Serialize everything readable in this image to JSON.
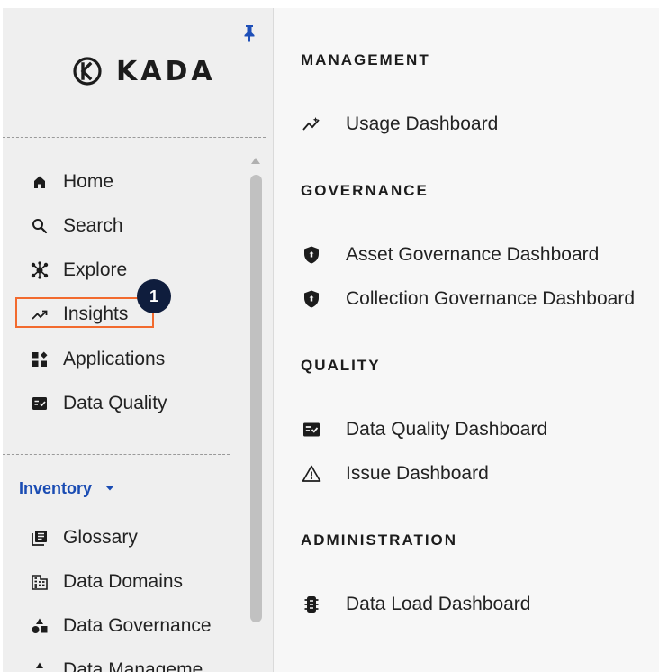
{
  "logo": {
    "text": "KADA"
  },
  "sidebar": {
    "nav": [
      {
        "label": "Home",
        "icon": "home-icon"
      },
      {
        "label": "Search",
        "icon": "search-icon"
      },
      {
        "label": "Explore",
        "icon": "explore-icon"
      },
      {
        "label": "Insights",
        "icon": "trending-up-icon"
      },
      {
        "label": "Applications",
        "icon": "applications-icon"
      },
      {
        "label": "Data Quality",
        "icon": "data-quality-icon"
      }
    ],
    "highlight_badge": "1",
    "inventory": {
      "label": "Inventory",
      "items": [
        {
          "label": "Glossary",
          "icon": "glossary-icon"
        },
        {
          "label": "Data Domains",
          "icon": "domains-icon"
        },
        {
          "label": "Data Governance",
          "icon": "governance-icon"
        },
        {
          "label": "Data Manageme",
          "icon": "management-icon"
        }
      ]
    }
  },
  "menu": {
    "sections": [
      {
        "title": "MANAGEMENT",
        "items": [
          {
            "label": "Usage Dashboard",
            "icon": "usage-icon"
          }
        ]
      },
      {
        "title": "GOVERNANCE",
        "items": [
          {
            "label": "Asset Governance Dashboard",
            "icon": "shield-icon"
          },
          {
            "label": "Collection Governance Dashboard",
            "icon": "shield-icon"
          }
        ]
      },
      {
        "title": "QUALITY",
        "items": [
          {
            "label": "Data Quality Dashboard",
            "icon": "data-quality-icon"
          },
          {
            "label": "Issue Dashboard",
            "icon": "warning-icon"
          }
        ]
      },
      {
        "title": "ADMINISTRATION",
        "items": [
          {
            "label": "Data Load Dashboard",
            "icon": "data-load-icon"
          }
        ]
      }
    ]
  },
  "colors": {
    "accent": "#1a4cb3",
    "highlight": "#f26a2e",
    "badge": "#0f1d3d"
  }
}
